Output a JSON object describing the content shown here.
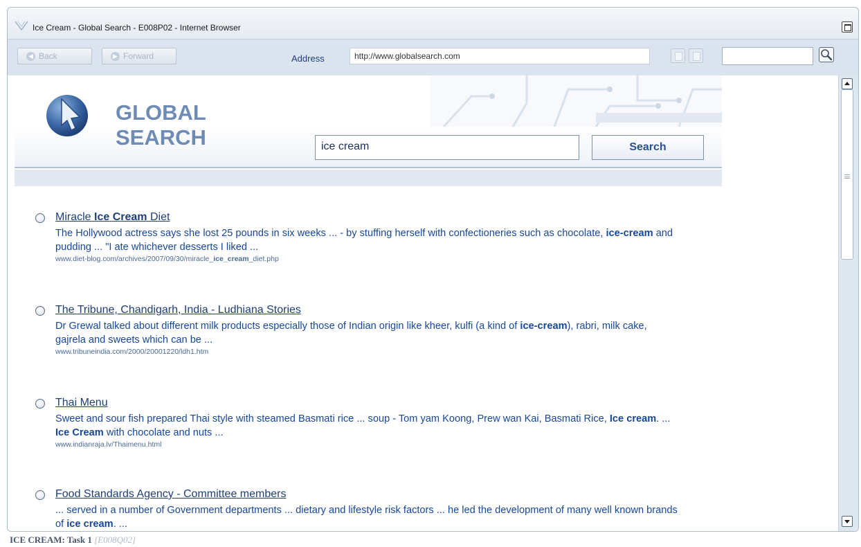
{
  "window": {
    "title": "Ice Cream - Global Search - E008P02 - Internet Browser"
  },
  "toolbar": {
    "back_label": "Back",
    "forward_label": "Forward",
    "address_label": "Address",
    "address_value": "http://www.globalsearch.com",
    "search_value": ""
  },
  "site": {
    "logo_line1": "GLOBAL",
    "logo_line2": "SEARCH",
    "query_value": "ice cream",
    "search_button_label": "Search"
  },
  "results": [
    {
      "title": [
        [
          "Miracle ",
          false
        ],
        [
          "Ice Cream",
          true
        ],
        [
          " Diet",
          false
        ]
      ],
      "snippet": [
        [
          "The Hollywood actress says she lost 25 pounds in six weeks ... - by stuffing herself with confectioneries such as chocolate, ",
          false
        ],
        [
          "ice-cream",
          true
        ],
        [
          " and pudding ... \"I ate whichever desserts I liked ...",
          false
        ]
      ],
      "url": [
        [
          "www.diet-blog.com/archives/2007/09/30/miracle_",
          false
        ],
        [
          "ice_cream",
          true
        ],
        [
          "_diet.php",
          false
        ]
      ]
    },
    {
      "title": [
        [
          "The Tribune, Chandigarh, India - Ludhiana Stories",
          false
        ]
      ],
      "snippet": [
        [
          "Dr Grewal talked about different milk products especially those of Indian origin like kheer, kulfi (a kind of ",
          false
        ],
        [
          "ice-cream",
          true
        ],
        [
          "), rabri, milk cake, gajrela and sweets which can be ...",
          false
        ]
      ],
      "url": [
        [
          "www.tribuneindia.com/2000/20001220/ldh1.htm",
          false
        ]
      ]
    },
    {
      "title": [
        [
          "Thai Menu",
          false
        ]
      ],
      "snippet": [
        [
          "Sweet and sour fish prepared Thai style with steamed Basmati rice ... soup - Tom yam Koong, Prew wan Kai, Basmati Rice, ",
          false
        ],
        [
          "Ice cream",
          true
        ],
        [
          ". ... ",
          false
        ],
        [
          "Ice Cream",
          true
        ],
        [
          " with chocolate and nuts ...",
          false
        ]
      ],
      "url": [
        [
          "www.indianraja.lv/Thaimenu.html",
          false
        ]
      ]
    },
    {
      "title": [
        [
          "Food Standards Agency - Committee members",
          false
        ]
      ],
      "snippet": [
        [
          "... served in a number of Government departments ... dietary and lifestyle risk factors ... he led the development of many well known brands of ",
          false
        ],
        [
          "ice cream",
          true
        ],
        [
          ". ...",
          false
        ]
      ],
      "url": []
    }
  ],
  "footer": {
    "task": "ICE CREAM: Task 1",
    "code": "[E008Q02]"
  },
  "colors": {
    "link": "#1e3e7a",
    "snippet": "#17479a",
    "logo": "#6e8bb6",
    "chrome": "#dbe4ee"
  },
  "icons": [
    "browser-logo-icon",
    "maximize-icon",
    "back-arrow-icon",
    "forward-arrow-icon",
    "copy-icon",
    "paste-icon",
    "magnifier-icon",
    "cursor-globe-icon",
    "scroll-up-icon",
    "scroll-down-icon"
  ]
}
